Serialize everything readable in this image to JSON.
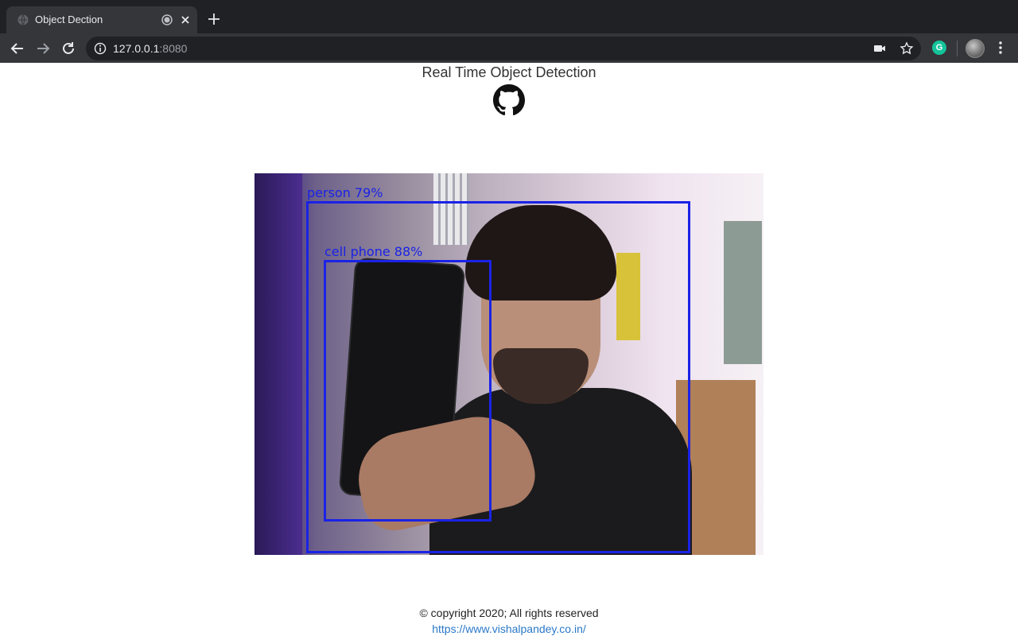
{
  "browser": {
    "tab": {
      "title": "Object Dection"
    },
    "address_bar": {
      "host": "127.0.0.1",
      "port": ":8080"
    },
    "extension_badge": "G"
  },
  "page": {
    "title": "Real Time Object Detection",
    "detections": [
      {
        "label": "person 79%"
      },
      {
        "label": "cell phone 88%"
      }
    ],
    "footer": {
      "copyright": "© copyright 2020; All rights reserved",
      "link_text": "https://www.vishalpandey.co.in/"
    }
  },
  "colors": {
    "chrome_dark": "#202124",
    "chrome_toolbar": "#35363a",
    "detection_box": "#1a22e6",
    "link": "#2a78c8"
  },
  "icons": [
    "globe-icon",
    "media-playing-icon",
    "close-icon",
    "plus-icon",
    "back-arrow-icon",
    "forward-arrow-icon",
    "reload-icon",
    "info-icon",
    "camera-icon",
    "star-icon",
    "grammarly-icon",
    "avatar",
    "kebab-menu-icon",
    "github-icon"
  ]
}
